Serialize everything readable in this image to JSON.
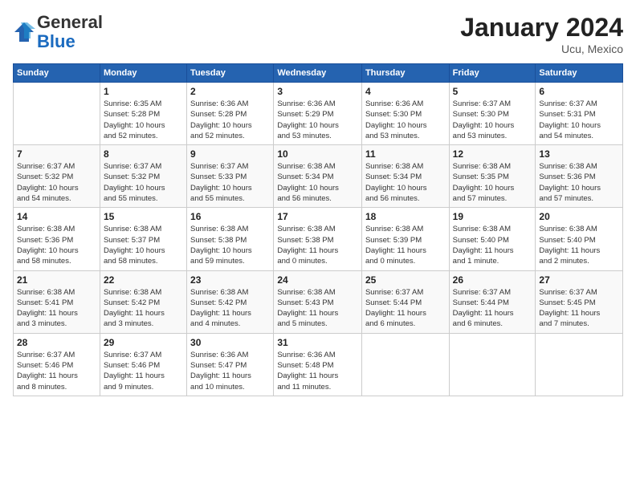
{
  "logo": {
    "general": "General",
    "blue": "Blue"
  },
  "title": "January 2024",
  "location": "Ucu, Mexico",
  "days_of_week": [
    "Sunday",
    "Monday",
    "Tuesday",
    "Wednesday",
    "Thursday",
    "Friday",
    "Saturday"
  ],
  "weeks": [
    [
      {
        "day": "",
        "info": ""
      },
      {
        "day": "1",
        "info": "Sunrise: 6:35 AM\nSunset: 5:28 PM\nDaylight: 10 hours\nand 52 minutes."
      },
      {
        "day": "2",
        "info": "Sunrise: 6:36 AM\nSunset: 5:28 PM\nDaylight: 10 hours\nand 52 minutes."
      },
      {
        "day": "3",
        "info": "Sunrise: 6:36 AM\nSunset: 5:29 PM\nDaylight: 10 hours\nand 53 minutes."
      },
      {
        "day": "4",
        "info": "Sunrise: 6:36 AM\nSunset: 5:30 PM\nDaylight: 10 hours\nand 53 minutes."
      },
      {
        "day": "5",
        "info": "Sunrise: 6:37 AM\nSunset: 5:30 PM\nDaylight: 10 hours\nand 53 minutes."
      },
      {
        "day": "6",
        "info": "Sunrise: 6:37 AM\nSunset: 5:31 PM\nDaylight: 10 hours\nand 54 minutes."
      }
    ],
    [
      {
        "day": "7",
        "info": "Sunrise: 6:37 AM\nSunset: 5:32 PM\nDaylight: 10 hours\nand 54 minutes."
      },
      {
        "day": "8",
        "info": "Sunrise: 6:37 AM\nSunset: 5:32 PM\nDaylight: 10 hours\nand 55 minutes."
      },
      {
        "day": "9",
        "info": "Sunrise: 6:37 AM\nSunset: 5:33 PM\nDaylight: 10 hours\nand 55 minutes."
      },
      {
        "day": "10",
        "info": "Sunrise: 6:38 AM\nSunset: 5:34 PM\nDaylight: 10 hours\nand 56 minutes."
      },
      {
        "day": "11",
        "info": "Sunrise: 6:38 AM\nSunset: 5:34 PM\nDaylight: 10 hours\nand 56 minutes."
      },
      {
        "day": "12",
        "info": "Sunrise: 6:38 AM\nSunset: 5:35 PM\nDaylight: 10 hours\nand 57 minutes."
      },
      {
        "day": "13",
        "info": "Sunrise: 6:38 AM\nSunset: 5:36 PM\nDaylight: 10 hours\nand 57 minutes."
      }
    ],
    [
      {
        "day": "14",
        "info": "Sunrise: 6:38 AM\nSunset: 5:36 PM\nDaylight: 10 hours\nand 58 minutes."
      },
      {
        "day": "15",
        "info": "Sunrise: 6:38 AM\nSunset: 5:37 PM\nDaylight: 10 hours\nand 58 minutes."
      },
      {
        "day": "16",
        "info": "Sunrise: 6:38 AM\nSunset: 5:38 PM\nDaylight: 10 hours\nand 59 minutes."
      },
      {
        "day": "17",
        "info": "Sunrise: 6:38 AM\nSunset: 5:38 PM\nDaylight: 11 hours\nand 0 minutes."
      },
      {
        "day": "18",
        "info": "Sunrise: 6:38 AM\nSunset: 5:39 PM\nDaylight: 11 hours\nand 0 minutes."
      },
      {
        "day": "19",
        "info": "Sunrise: 6:38 AM\nSunset: 5:40 PM\nDaylight: 11 hours\nand 1 minute."
      },
      {
        "day": "20",
        "info": "Sunrise: 6:38 AM\nSunset: 5:40 PM\nDaylight: 11 hours\nand 2 minutes."
      }
    ],
    [
      {
        "day": "21",
        "info": "Sunrise: 6:38 AM\nSunset: 5:41 PM\nDaylight: 11 hours\nand 3 minutes."
      },
      {
        "day": "22",
        "info": "Sunrise: 6:38 AM\nSunset: 5:42 PM\nDaylight: 11 hours\nand 3 minutes."
      },
      {
        "day": "23",
        "info": "Sunrise: 6:38 AM\nSunset: 5:42 PM\nDaylight: 11 hours\nand 4 minutes."
      },
      {
        "day": "24",
        "info": "Sunrise: 6:38 AM\nSunset: 5:43 PM\nDaylight: 11 hours\nand 5 minutes."
      },
      {
        "day": "25",
        "info": "Sunrise: 6:37 AM\nSunset: 5:44 PM\nDaylight: 11 hours\nand 6 minutes."
      },
      {
        "day": "26",
        "info": "Sunrise: 6:37 AM\nSunset: 5:44 PM\nDaylight: 11 hours\nand 6 minutes."
      },
      {
        "day": "27",
        "info": "Sunrise: 6:37 AM\nSunset: 5:45 PM\nDaylight: 11 hours\nand 7 minutes."
      }
    ],
    [
      {
        "day": "28",
        "info": "Sunrise: 6:37 AM\nSunset: 5:46 PM\nDaylight: 11 hours\nand 8 minutes."
      },
      {
        "day": "29",
        "info": "Sunrise: 6:37 AM\nSunset: 5:46 PM\nDaylight: 11 hours\nand 9 minutes."
      },
      {
        "day": "30",
        "info": "Sunrise: 6:36 AM\nSunset: 5:47 PM\nDaylight: 11 hours\nand 10 minutes."
      },
      {
        "day": "31",
        "info": "Sunrise: 6:36 AM\nSunset: 5:48 PM\nDaylight: 11 hours\nand 11 minutes."
      },
      {
        "day": "",
        "info": ""
      },
      {
        "day": "",
        "info": ""
      },
      {
        "day": "",
        "info": ""
      }
    ]
  ]
}
